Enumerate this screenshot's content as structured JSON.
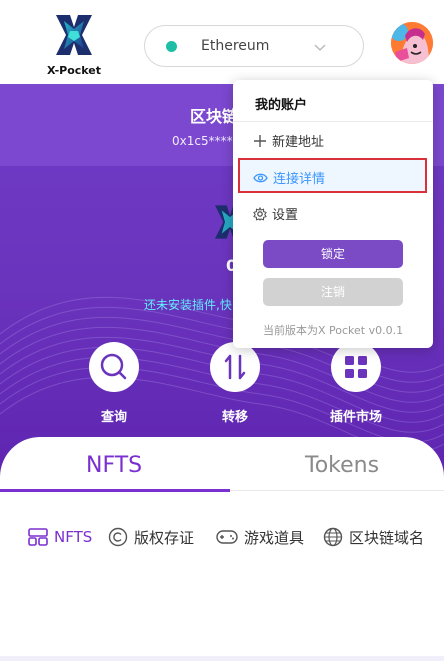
{
  "header": {
    "logo_text": "X-Pocket",
    "network": {
      "label": "Ethereum",
      "dot_color": "#1ebea5"
    }
  },
  "hero": {
    "title": "区块链",
    "address": "0x1c5*****",
    "balance": "0",
    "notice": "还未安装插件,快",
    "actions": [
      {
        "label": "查询",
        "icon": "search-icon"
      },
      {
        "label": "转移",
        "icon": "transfer-icon"
      },
      {
        "label": "插件市场",
        "icon": "grid-icon"
      }
    ]
  },
  "tabs": [
    {
      "label": "NFTS",
      "active": true
    },
    {
      "label": "Tokens",
      "active": false
    }
  ],
  "categories": [
    {
      "label": "NFTS",
      "icon": "nft-icon",
      "active": true
    },
    {
      "label": "版权存证",
      "icon": "copyright-icon",
      "active": false
    },
    {
      "label": "游戏道具",
      "icon": "gamepad-icon",
      "active": false
    },
    {
      "label": "区块链域名",
      "icon": "globe-icon",
      "active": false
    }
  ],
  "account_menu": {
    "title": "我的账户",
    "items": [
      {
        "label": "新建地址",
        "icon": "plus-icon"
      },
      {
        "label": "连接详情",
        "icon": "eye-icon",
        "highlighted": true
      },
      {
        "label": "设置",
        "icon": "gear-icon"
      }
    ],
    "lock_label": "锁定",
    "logout_label": "注销",
    "version_text": "当前版本为X Pocket v0.0.1"
  },
  "colors": {
    "brand_purple": "#7a2fd0",
    "hero_purple": "#6f3bc7",
    "highlight_border": "#d9303a",
    "link_blue": "#3b96ff"
  }
}
